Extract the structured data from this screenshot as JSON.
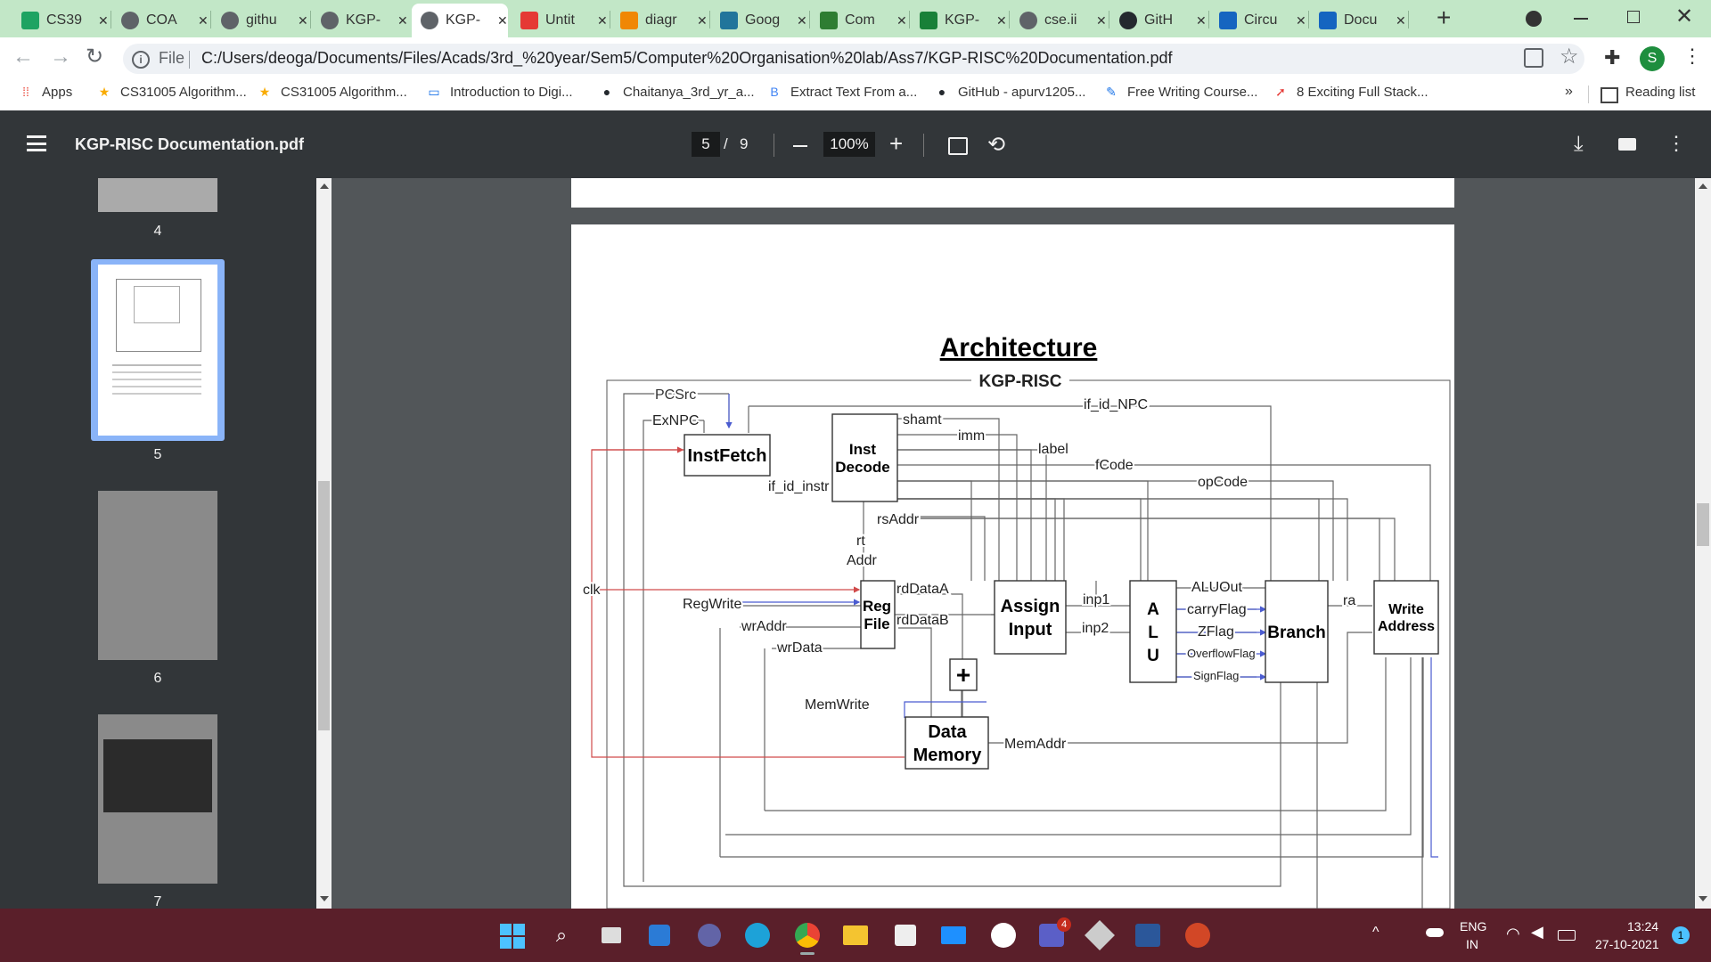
{
  "browser": {
    "tabs": [
      {
        "title": "CS39",
        "icon": "sheets-icon",
        "color": "#1ea362"
      },
      {
        "title": "COA",
        "icon": "globe-icon",
        "color": "#5f6368"
      },
      {
        "title": "githu",
        "icon": "globe-icon",
        "color": "#5f6368"
      },
      {
        "title": "KGP-",
        "icon": "globe-icon",
        "color": "#5f6368"
      },
      {
        "title": "KGP-",
        "icon": "globe-icon",
        "color": "#5f6368",
        "active": true
      },
      {
        "title": "Untit",
        "icon": "slides-icon",
        "color": "#e53935"
      },
      {
        "title": "diagr",
        "icon": "diagram-icon",
        "color": "#f08705"
      },
      {
        "title": "Goog",
        "icon": "wordpress-icon",
        "color": "#21759b"
      },
      {
        "title": "Com",
        "icon": "compare-icon",
        "color": "#2e7d32"
      },
      {
        "title": "KGP-",
        "icon": "drive-icon",
        "color": "#188038"
      },
      {
        "title": "cse.ii",
        "icon": "globe-icon",
        "color": "#5f6368"
      },
      {
        "title": "GitH",
        "icon": "github-icon",
        "color": "#24292e"
      },
      {
        "title": "Circu",
        "icon": "circuitverse-icon",
        "color": "#1565c0"
      },
      {
        "title": "Docu",
        "icon": "circuitverse-icon",
        "color": "#1565c0"
      }
    ],
    "new_tab": "+",
    "address": {
      "info": "File",
      "url": "C:/Users/deoga/Documents/Files/Acads/3rd_%20year/Sem5/Computer%20Organisation%20lab/Ass7/KGP-RISC%20Documentation.pdf"
    },
    "profile_initial": "S",
    "bookmarks": [
      {
        "label": "Apps",
        "icon": "apps-grid-icon"
      },
      {
        "label": "CS31005 Algorithm...",
        "icon": "star-icon"
      },
      {
        "label": "CS31005 Algorithm...",
        "icon": "star-icon"
      },
      {
        "label": "Introduction to Digi...",
        "icon": "page-icon"
      },
      {
        "label": "Chaitanya_3rd_yr_a...",
        "icon": "github-icon"
      },
      {
        "label": "Extract Text From a...",
        "icon": "b-icon"
      },
      {
        "label": "GitHub - apurv1205...",
        "icon": "github-icon"
      },
      {
        "label": "Free Writing Course...",
        "icon": "pen-icon"
      },
      {
        "label": "8 Exciting Full Stack...",
        "icon": "arrow-icon"
      }
    ],
    "bookmarks_more": "»",
    "reading_list": "Reading list"
  },
  "pdf": {
    "filename": "KGP-RISC Documentation.pdf",
    "page_current": "5",
    "page_sep": "/",
    "page_total": "9",
    "zoom": "100%",
    "thumbnails": [
      {
        "num": "4"
      },
      {
        "num": "5",
        "selected": true
      },
      {
        "num": "6"
      },
      {
        "num": "7"
      }
    ]
  },
  "diagram": {
    "title": "Architecture",
    "subtitle": "KGP-RISC",
    "blocks": {
      "instfetch": "InstFetch",
      "instdecode1": "Inst",
      "instdecode2": "Decode",
      "regfile1": "Reg",
      "regfile2": "File",
      "assign1": "Assign",
      "assign2": "Input",
      "alu1": "A",
      "alu2": "L",
      "alu3": "U",
      "branch": "Branch",
      "write1": "Write",
      "write2": "Address",
      "mem1": "Data",
      "mem2": "Memory",
      "adder": "+"
    },
    "labels": {
      "pcsrc": "PCSrc",
      "exnpc": "ExNPC",
      "if_id_instr": "if_id_instr",
      "shamt": "shamt",
      "imm": "imm",
      "label": "label",
      "fcode": "fCode",
      "opcode": "opCode",
      "if_id_npc": "if_id_NPC",
      "rsaddr": "rsAddr",
      "rt": "rt",
      "addr": "Addr",
      "clk": "clk",
      "regwrite": "RegWrite",
      "wraddr": "wrAddr",
      "wrdata": "wrData",
      "rddataa": "rdDataA",
      "rddatab": "rdDataB",
      "inp1": "inp1",
      "inp2": "inp2",
      "aluout": "ALUOut",
      "carryflag": "carryFlag",
      "zflag": "ZFlag",
      "overflowflag": "OverflowFlag",
      "signflag": "SignFlag",
      "ra": "ra",
      "memwrite": "MemWrite",
      "memaddr": "MemAddr"
    }
  },
  "taskbar": {
    "lang1": "ENG",
    "lang2": "IN",
    "time": "13:24",
    "date": "27-10-2021",
    "notif": "1",
    "teams_badge": "4"
  }
}
